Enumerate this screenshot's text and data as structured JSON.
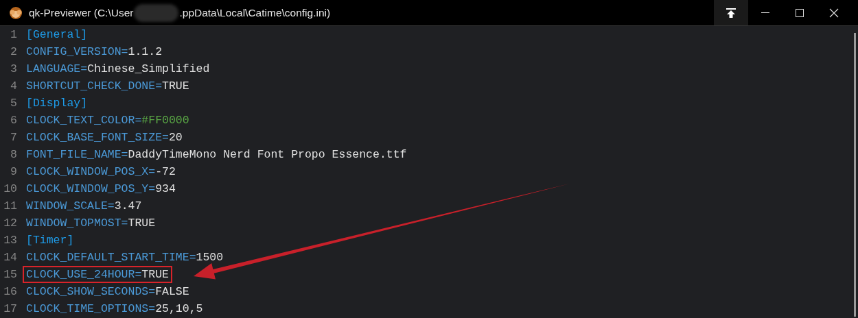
{
  "window": {
    "title_start": "qk-Previewer (C:\\User",
    "title_end": ".ppData\\Local\\Catime\\config.ini)",
    "pin": {
      "on": true
    }
  },
  "lines": [
    {
      "number": "1",
      "kind": "section",
      "text": "[General]",
      "highlighted": false
    },
    {
      "number": "2",
      "kind": "entry",
      "key": "CONFIG_VERSION=",
      "value": "1.1.2",
      "highlighted": false
    },
    {
      "number": "3",
      "kind": "entry",
      "key": "LANGUAGE=",
      "value": "Chinese_Simplified",
      "highlighted": false
    },
    {
      "number": "4",
      "kind": "entry",
      "key": "SHORTCUT_CHECK_DONE=",
      "value": "TRUE",
      "highlighted": false
    },
    {
      "number": "5",
      "kind": "section",
      "text": "[Display]",
      "highlighted": false
    },
    {
      "number": "6",
      "kind": "color_entry",
      "key": "CLOCK_TEXT_COLOR=",
      "value": "#FF0000",
      "highlighted": false
    },
    {
      "number": "7",
      "kind": "entry",
      "key": "CLOCK_BASE_FONT_SIZE=",
      "value": "20",
      "highlighted": false
    },
    {
      "number": "8",
      "kind": "entry",
      "key": "FONT_FILE_NAME=",
      "value": "DaddyTimeMono Nerd Font Propo Essence.ttf",
      "highlighted": false
    },
    {
      "number": "9",
      "kind": "entry",
      "key": "CLOCK_WINDOW_POS_X=",
      "value": "-72",
      "highlighted": false
    },
    {
      "number": "10",
      "kind": "entry",
      "key": "CLOCK_WINDOW_POS_Y=",
      "value": "934",
      "highlighted": false
    },
    {
      "number": "11",
      "kind": "entry",
      "key": "WINDOW_SCALE=",
      "value": "3.47",
      "highlighted": false
    },
    {
      "number": "12",
      "kind": "entry",
      "key": "WINDOW_TOPMOST=",
      "value": "TRUE",
      "highlighted": false
    },
    {
      "number": "13",
      "kind": "section",
      "text": "[Timer]",
      "highlighted": false
    },
    {
      "number": "14",
      "kind": "entry",
      "key": "CLOCK_DEFAULT_START_TIME=",
      "value": "1500",
      "highlighted": false
    },
    {
      "number": "15",
      "kind": "entry",
      "key": "CLOCK_USE_24HOUR=",
      "value": "TRUE",
      "highlighted": true
    },
    {
      "number": "16",
      "kind": "entry",
      "key": "CLOCK_SHOW_SECONDS=",
      "value": "FALSE",
      "highlighted": false
    },
    {
      "number": "17",
      "kind": "entry",
      "key": "CLOCK_TIME_OPTIONS=",
      "value": "25,10,5",
      "highlighted": false
    }
  ]
}
